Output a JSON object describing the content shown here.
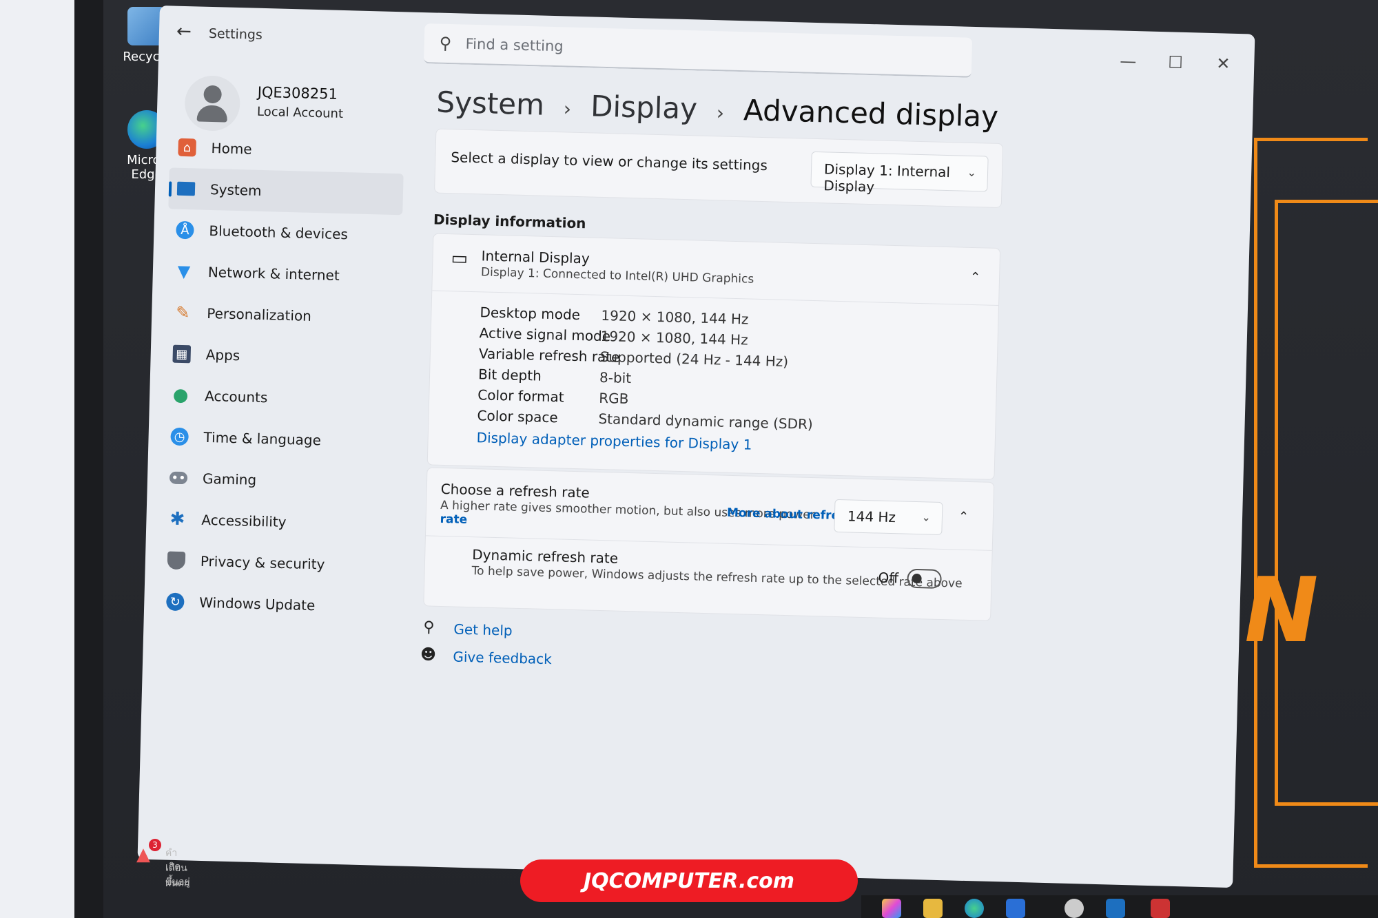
{
  "desktop": {
    "icons": [
      {
        "label": "Recycle",
        "icon": "recycle-bin-icon"
      },
      {
        "label": "Micros",
        "label2": "Edge",
        "icon": "edge-icon"
      }
    ],
    "wallpaper_accent": "#f08a18",
    "wallpaper_letter": "N"
  },
  "window": {
    "title": "Settings",
    "search_placeholder": "Find a setting",
    "controls": [
      "minimize",
      "maximize",
      "close"
    ]
  },
  "profile": {
    "name": "JQE308251",
    "type": "Local Account"
  },
  "nav": {
    "items": [
      {
        "label": "Home",
        "icon": "home-icon",
        "color": "#e0603a"
      },
      {
        "label": "System",
        "icon": "system-icon",
        "color": "#1d6fbf",
        "active": true
      },
      {
        "label": "Bluetooth & devices",
        "icon": "bluetooth-icon",
        "color": "#2a8fe8"
      },
      {
        "label": "Network & internet",
        "icon": "wifi-icon",
        "color": "#2a8fe8"
      },
      {
        "label": "Personalization",
        "icon": "brush-icon",
        "color": "#d6782b"
      },
      {
        "label": "Apps",
        "icon": "apps-icon",
        "color": "#3b4a66"
      },
      {
        "label": "Accounts",
        "icon": "accounts-icon",
        "color": "#2aa36b"
      },
      {
        "label": "Time & language",
        "icon": "globe-clock-icon",
        "color": "#2a8fe8"
      },
      {
        "label": "Gaming",
        "icon": "gamepad-icon",
        "color": "#7d8591"
      },
      {
        "label": "Accessibility",
        "icon": "accessibility-icon",
        "color": "#1d6fbf"
      },
      {
        "label": "Privacy & security",
        "icon": "shield-icon",
        "color": "#6a6f78"
      },
      {
        "label": "Windows Update",
        "icon": "update-icon",
        "color": "#1d6fbf"
      }
    ]
  },
  "breadcrumb": {
    "items": [
      "System",
      "Display",
      "Advanced display"
    ],
    "separator": "›"
  },
  "select_display": {
    "label": "Select a display to view or change its settings",
    "value": "Display 1: Internal Display"
  },
  "display_info": {
    "section_title": "Display information",
    "device_name": "Internal Display",
    "device_sub": "Display 1: Connected to Intel(R) UHD Graphics",
    "rows": [
      {
        "label": "Desktop mode",
        "value": "1920 × 1080, 144 Hz"
      },
      {
        "label": "Active signal mode",
        "value": "1920 × 1080, 144 Hz"
      },
      {
        "label": "Variable refresh rate",
        "value": "Supported (24 Hz - 144 Hz)"
      },
      {
        "label": "Bit depth",
        "value": "8-bit"
      },
      {
        "label": "Color format",
        "value": "RGB"
      },
      {
        "label": "Color space",
        "value": "Standard dynamic range (SDR)"
      }
    ],
    "adapter_link": "Display adapter properties for Display 1"
  },
  "refresh": {
    "title": "Choose a refresh rate",
    "desc": "A higher rate gives smoother motion, but also uses more power",
    "link": "More about refresh",
    "link_cont": "rate",
    "value": "144 Hz",
    "dynamic_title": "Dynamic refresh rate",
    "dynamic_desc": "To help save power, Windows adjusts the refresh rate up to the selected rate above",
    "dynamic_state": "Off"
  },
  "help": {
    "get_help": "Get help",
    "feedback": "Give feedback"
  },
  "notification": {
    "badge": "3",
    "line1": "คำเตือนฝนตก",
    "line2": "เกิดขึ้นอยู่"
  },
  "banner": {
    "text": "JQCOMPUTER.com",
    "color": "#ee1c24"
  }
}
